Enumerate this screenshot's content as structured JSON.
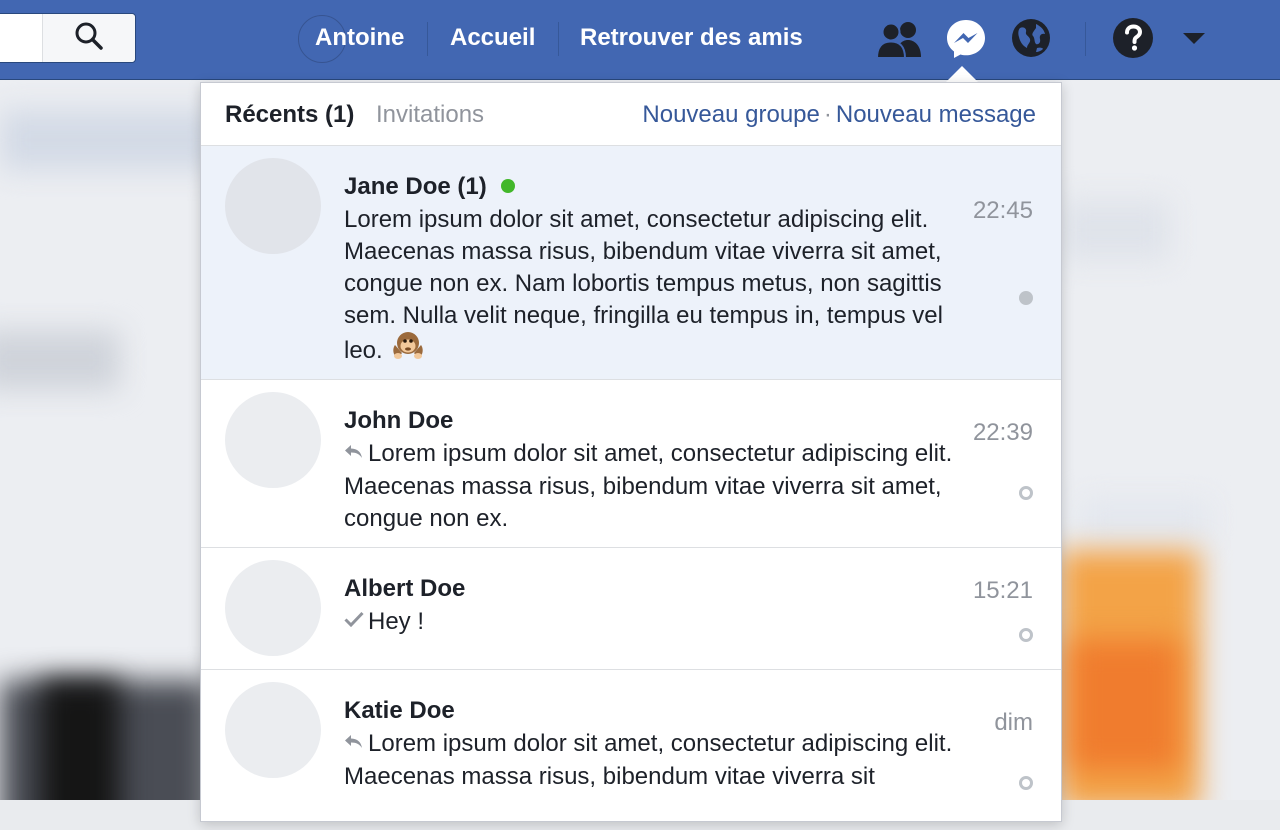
{
  "topbar": {
    "nav": [
      {
        "label": "Antoine"
      },
      {
        "label": "Accueil"
      },
      {
        "label": "Retrouver des amis"
      }
    ],
    "colors": {
      "bar": "#4267b2",
      "link": "#365899",
      "online": "#42b72a"
    }
  },
  "panel": {
    "tabs": [
      {
        "label": "Récents (1)",
        "active": true
      },
      {
        "label": "Invitations",
        "active": false
      }
    ],
    "new_group": "Nouveau groupe",
    "separator": "·",
    "new_message": "Nouveau message"
  },
  "conversations": [
    {
      "name": "Jane Doe (1)",
      "online": true,
      "unread": true,
      "prefix_icon": "monkey-emoji",
      "snippet": "Lorem ipsum dolor sit amet, consectetur adipiscing elit. Maecenas massa risus, bibendum vitae viverra sit amet, congue non ex. Nam lobortis tempus metus, non sagittis sem. Nulla velit neque, fringilla eu tempus in, tempus vel leo.",
      "time": "22:45",
      "status": "filled"
    },
    {
      "name": "John Doe",
      "online": false,
      "unread": false,
      "prefix_icon": "reply-icon",
      "snippet": "Lorem ipsum dolor sit amet, consectetur adipiscing elit. Maecenas massa risus, bibendum vitae viverra sit amet, congue non ex.",
      "time": "22:39",
      "status": "ring"
    },
    {
      "name": "Albert Doe",
      "online": false,
      "unread": false,
      "prefix_icon": "check-icon",
      "snippet": "Hey !",
      "time": "15:21",
      "status": "ring"
    },
    {
      "name": "Katie Doe",
      "online": false,
      "unread": false,
      "prefix_icon": "reply-icon",
      "snippet": "Lorem ipsum dolor sit amet, consectetur adipiscing elit. Maecenas massa risus, bibendum vitae viverra sit",
      "time": "dim",
      "status": "ring"
    }
  ]
}
